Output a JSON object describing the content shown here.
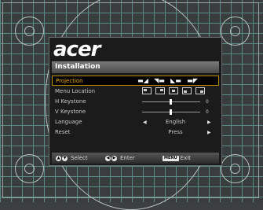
{
  "brand": "acer",
  "menu_title": "Installation",
  "rows": [
    {
      "label": "Projection"
    },
    {
      "label": "Menu Location"
    },
    {
      "label": "H Keystone",
      "value": "0"
    },
    {
      "label": "V Keystone",
      "value": "0"
    },
    {
      "label": "Language",
      "value": "English"
    },
    {
      "label": "Reset",
      "value": "Press"
    }
  ],
  "keystone": {
    "h": 0,
    "v": 0
  },
  "footer": {
    "select": "Select",
    "enter": "Enter",
    "menu_key": "MENU",
    "exit": "Exit"
  },
  "colors": {
    "highlight": "#f0a800",
    "grid": "#5a8a86",
    "panel": "#1b1b1b"
  }
}
